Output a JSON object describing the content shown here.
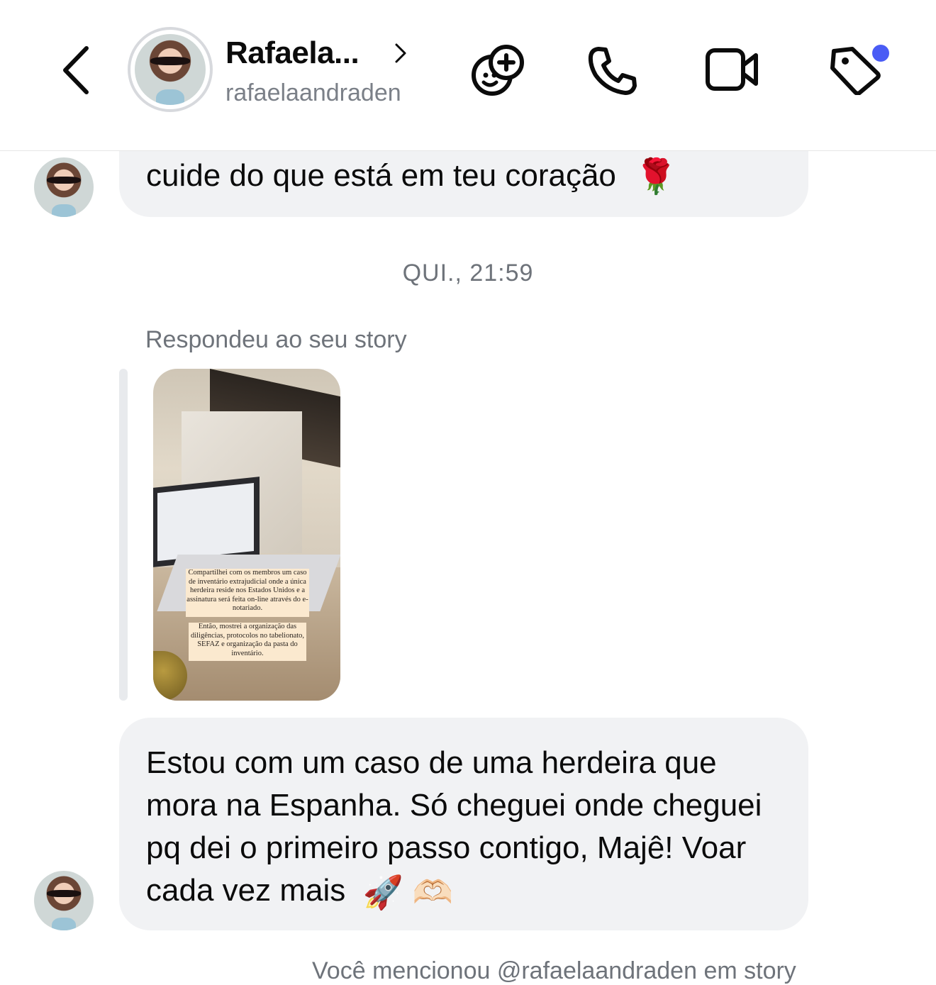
{
  "header": {
    "name": "Rafaela...",
    "username": "rafaelaandraden",
    "icons": [
      "back-arrow-icon",
      "chevron-right-icon",
      "add-to-group-icon",
      "phone-icon",
      "video-camera-icon",
      "tag-icon"
    ],
    "tag_badge_color": "#4a5cf5"
  },
  "messages": {
    "first_text": "cuide do que está em teu coração",
    "first_emoji": "🌹",
    "timestamp": "QUI., 21:59",
    "reply_label": "Respondeu ao seu story",
    "story_caption_1": "Compartilhei com os membros um caso de inventário extrajudicial onde a única herdeira reside nos Estados Unidos e a assinatura será feita on-line através do e-notariado.",
    "story_caption_2": "Então, mostrei a organização das diligências, protocolos no tabelionato, SEFAZ e organização da pasta do inventário.",
    "second_text": "Estou com um caso de uma herdeira que mora na Espanha. Só cheguei onde cheguei pq dei o primeiro passo contigo, Majê! Voar cada vez mais",
    "second_emojis": "🚀 🫶🏻"
  },
  "footer": {
    "cut_text": "Você mencionou @rafaelaandraden em story"
  },
  "colors": {
    "bubble_bg": "#f1f2f4",
    "secondary_text": "#6e737a"
  }
}
